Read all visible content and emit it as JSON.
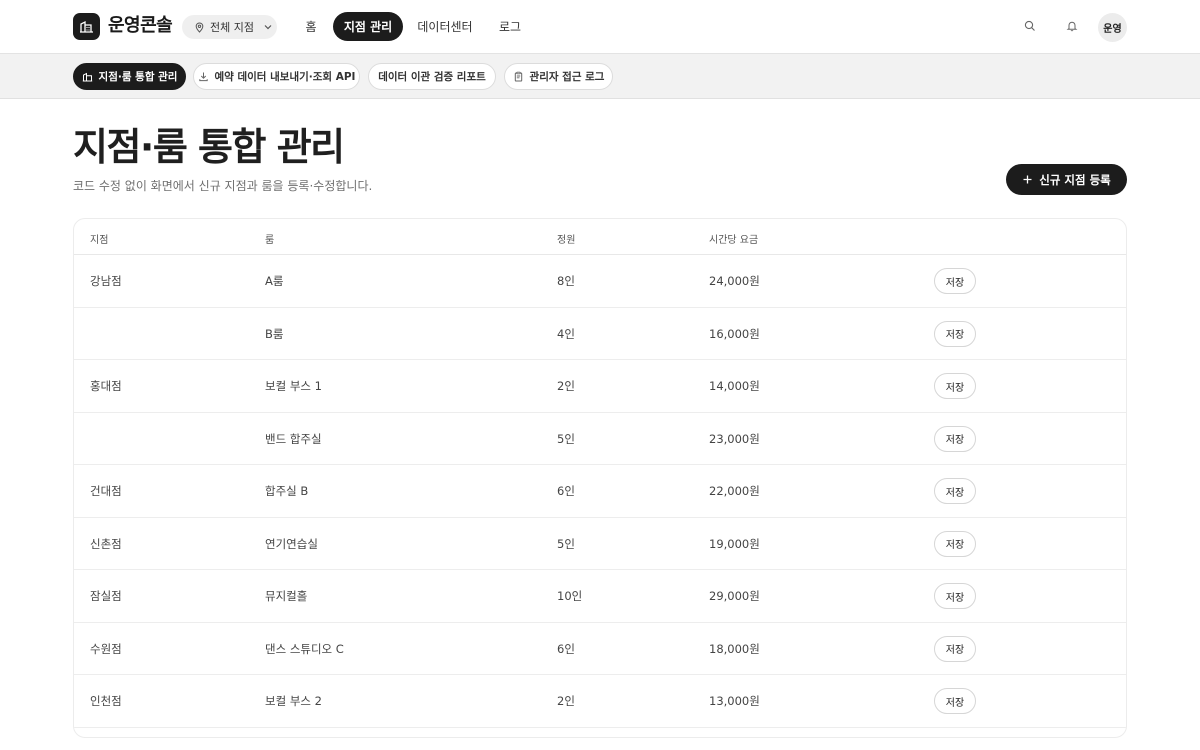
{
  "header": {
    "brand": "운영콘솔",
    "branch_select": "전체 지점",
    "nav": [
      "홈",
      "지점 관리",
      "데이터센터",
      "로그"
    ],
    "nav_active": "지점 관리",
    "avatar": "운영"
  },
  "subtabs": [
    {
      "label": "지점·룸 통합 관리",
      "icon": "building-icon",
      "active": true
    },
    {
      "label": "예약 데이터 내보내기·조회 API",
      "icon": "download-icon",
      "active": false
    },
    {
      "label": "데이터 이관 검증 리포트",
      "icon": "",
      "active": false
    },
    {
      "label": "관리자 접근 로그",
      "icon": "clipboard-icon",
      "active": false
    }
  ],
  "page": {
    "title": "지점·룸 통합 관리",
    "description": "코드 수정 없이 화면에서 신규 지점과 룸을 등록·수정합니다.",
    "add_button": "신규 지점 등록"
  },
  "table": {
    "headers": [
      "지점",
      "룸",
      "정원",
      "시간당 요금"
    ],
    "save_label": "저장",
    "rows": [
      {
        "branch": "강남점",
        "room": "A룸",
        "capacity": "8인",
        "price": "24,000원"
      },
      {
        "branch": "",
        "room": "B룸",
        "capacity": "4인",
        "price": "16,000원"
      },
      {
        "branch": "홍대점",
        "room": "보컬 부스 1",
        "capacity": "2인",
        "price": "14,000원"
      },
      {
        "branch": "",
        "room": "밴드 합주실",
        "capacity": "5인",
        "price": "23,000원"
      },
      {
        "branch": "건대점",
        "room": "합주실 B",
        "capacity": "6인",
        "price": "22,000원"
      },
      {
        "branch": "신촌점",
        "room": "연기연습실",
        "capacity": "5인",
        "price": "19,000원"
      },
      {
        "branch": "잠실점",
        "room": "뮤지컬홀",
        "capacity": "10인",
        "price": "29,000원"
      },
      {
        "branch": "수원점",
        "room": "댄스 스튜디오 C",
        "capacity": "6인",
        "price": "18,000원"
      },
      {
        "branch": "인천점",
        "room": "보컬 부스 2",
        "capacity": "2인",
        "price": "13,000원"
      }
    ]
  },
  "colors": {
    "accent": "#1c1c1c",
    "background": "#ffffff",
    "subbar": "#f2f2f2"
  }
}
